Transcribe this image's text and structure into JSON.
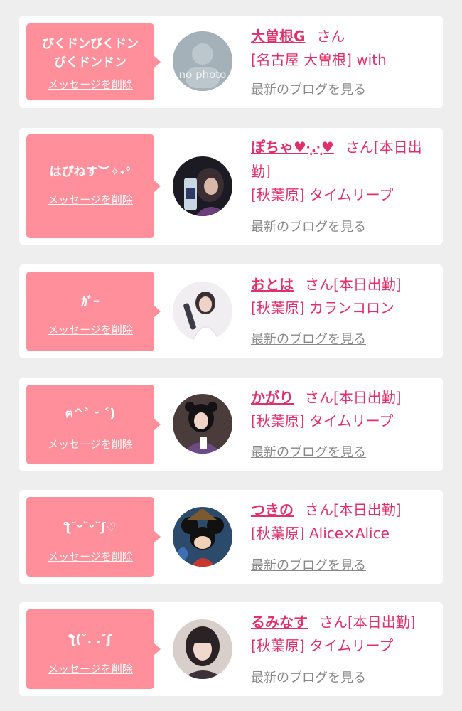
{
  "colors": {
    "accent": "#e0306a",
    "bubble": "#ff8f9b",
    "link_gray": "#888888",
    "background": "#eeeeee"
  },
  "items": [
    {
      "message": "びくドンびくドン\nびくドンドン",
      "delete_label": "メッセージを削除",
      "avatar": "no-photo",
      "avatar_text": "no photo",
      "name": "大曽根G",
      "honorific": "さん",
      "status": "",
      "shop_line": "[名古屋 大曽根] with",
      "blog_label": "最新のブログを見る"
    },
    {
      "message": "はぴねす︶✧˖°",
      "delete_label": "メッセージを削除",
      "avatar": "photo",
      "name": "ぽちゃ♥︎·̩͙.·̩͙♥︎",
      "honorific": "さん",
      "status": "[本日出勤]",
      "shop_line": "[秋葉原] タイムリープ",
      "blog_label": "最新のブログを見る"
    },
    {
      "message": "ｶﾞｰ",
      "delete_label": "メッセージを削除",
      "avatar": "photo",
      "name": "おとは",
      "honorific": "さん",
      "status": "[本日出勤]",
      "shop_line": "[秋葉原] カランコロン",
      "blog_label": "最新のブログを見る"
    },
    {
      "message": "ฅ^˃ ᵕ ˂)",
      "delete_label": "メッセージを削除",
      "avatar": "photo",
      "name": "かがり",
      "honorific": "さん",
      "status": "[本日出勤]",
      "shop_line": "[秋葉原] タイムリープ",
      "blog_label": "最新のブログを見る"
    },
    {
      "message": "ƪ˘ᵕ˘ᵕ˘ʃ♡",
      "delete_label": "メッセージを削除",
      "avatar": "photo",
      "name": "つきの",
      "honorific": "さん",
      "status": "[本日出勤]",
      "shop_line": "[秋葉原] Alice×Alice",
      "blog_label": "最新のブログを見る"
    },
    {
      "message": "ƪ(˘. .˘ʃ",
      "delete_label": "メッセージを削除",
      "avatar": "photo",
      "name": "るみなす",
      "honorific": "さん",
      "status": "[本日出勤]",
      "shop_line": "[秋葉原] タイムリープ",
      "blog_label": "最新のブログを見る"
    }
  ]
}
